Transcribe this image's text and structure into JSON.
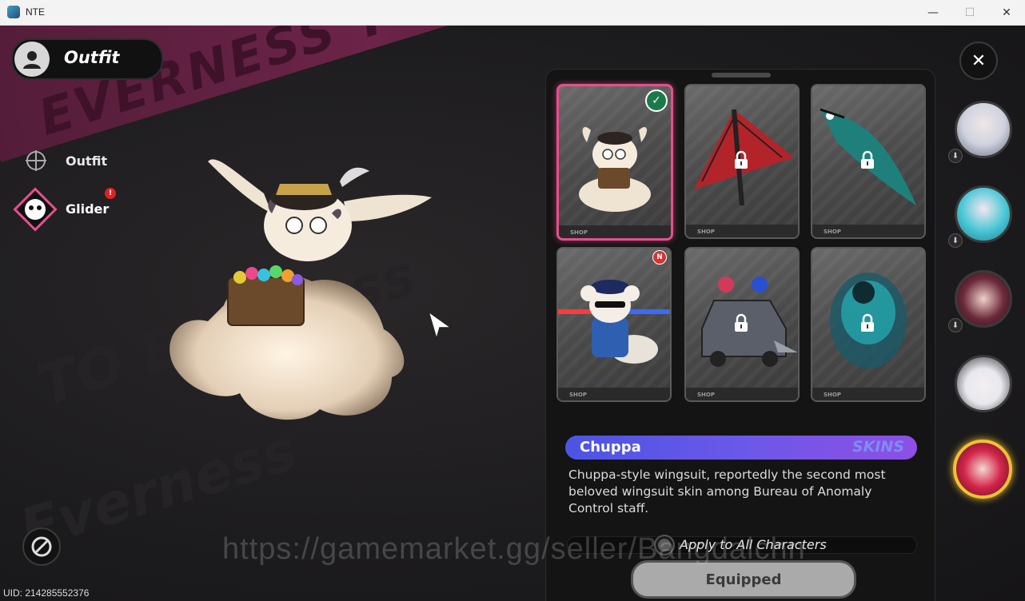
{
  "window": {
    "title": "NTE",
    "controls": {
      "minimize": "—",
      "maximize": "☐",
      "close": "✕"
    }
  },
  "header": {
    "label": "Outfit"
  },
  "sidebar": {
    "items": [
      {
        "label": "Outfit",
        "icon": "crosshair-icon"
      },
      {
        "label": "Glider",
        "icon": "glider-icon",
        "alert": "!"
      }
    ]
  },
  "close_button": "✕",
  "background": {
    "banner_text": "EVERNESS TO EVERNESS",
    "bg_text_1": "TO Everness",
    "bg_text_2": "Everness"
  },
  "skins": [
    {
      "id": "chuppa",
      "shop": "SHOP",
      "locked": false,
      "equipped": true,
      "new": false,
      "color": "#d9cfc0"
    },
    {
      "id": "red-kite",
      "shop": "SHOP",
      "locked": true,
      "equipped": false,
      "new": false,
      "color": "#b3232a"
    },
    {
      "id": "koi-fish",
      "shop": "SHOP",
      "locked": true,
      "equipped": false,
      "new": false,
      "color": "#1f7f7a"
    },
    {
      "id": "police-chuppa",
      "shop": "SHOP",
      "locked": false,
      "equipped": false,
      "new": true,
      "new_label": "N",
      "color": "#2f5fb0"
    },
    {
      "id": "police-car",
      "shop": "SHOP",
      "locked": true,
      "equipped": false,
      "new": false,
      "color": "#5a5f6a"
    },
    {
      "id": "spirit",
      "shop": "SHOP",
      "locked": true,
      "equipped": false,
      "new": false,
      "color": "#24b0b8"
    }
  ],
  "detail": {
    "name": "Chuppa",
    "tag": "SKINS",
    "description": "Chuppa-style wingsuit, reportedly the second most beloved wingsuit skin among Bureau of Anomaly Control staff."
  },
  "apply_all_label": "Apply to All Characters",
  "equip_button": "Equipped",
  "characters": [
    {
      "name": "character-1",
      "hair": "#cfd3e0",
      "active": false,
      "download": true
    },
    {
      "name": "character-2",
      "hair": "#45c6d6",
      "active": false,
      "download": true
    },
    {
      "name": "character-3",
      "hair": "#6b2a3a",
      "active": false,
      "download": true
    },
    {
      "name": "character-4",
      "hair": "#e8e8ee",
      "active": false,
      "download": false
    },
    {
      "name": "character-5",
      "hair": "#d3254a",
      "active": true,
      "download": false
    }
  ],
  "uid": "UID: 214285552376",
  "watermark": "https://gamemarket.gg/seller/Bangdalchn",
  "colors": {
    "accent_pink": "#e64f8e",
    "active_gold": "#f2c233",
    "name_bar": "#5a56e6"
  }
}
